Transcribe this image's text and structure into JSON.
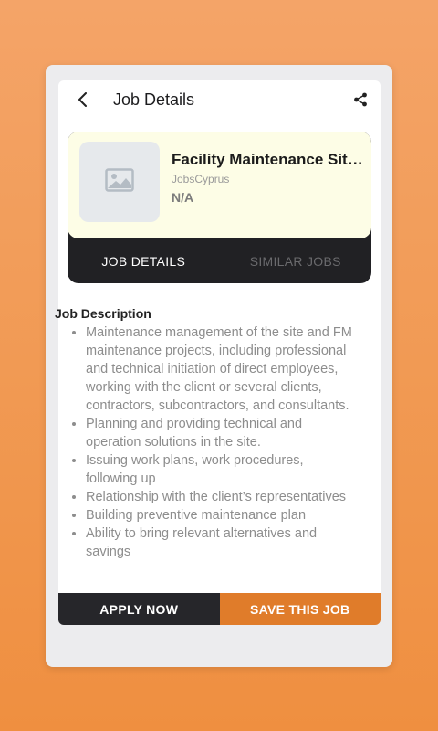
{
  "appbar": {
    "title": "Job Details",
    "back_icon": "chevron-left-icon",
    "share_icon": "share-icon"
  },
  "job": {
    "title": "Facility Maintenance Site Manager",
    "company": "JobsCyprus",
    "salary": "N/A",
    "logo_icon": "image-placeholder-icon"
  },
  "tabs": [
    {
      "label": "JOB DETAILS",
      "active": true
    },
    {
      "label": "SIMILAR JOBS",
      "active": false
    }
  ],
  "description": {
    "heading": "Job Description",
    "items": [
      "Maintenance management of the site and FM maintenance projects, including professional and technical initiation of direct employees, working with the client or several clients, contractors, subcontractors, and consultants.",
      "Planning and providing technical and operation solutions in the site.",
      "Issuing work plans, work procedures, following up",
      "Relationship with the client’s representatives",
      "Building preventive maintenance plan",
      "Ability to bring relevant alternatives and savings"
    ]
  },
  "actions": {
    "apply_label": "APPLY NOW",
    "save_label": "SAVE THIS JOB"
  },
  "colors": {
    "accent": "#e07c2a",
    "dark": "#26262a",
    "header_bg": "#fdfde6"
  }
}
